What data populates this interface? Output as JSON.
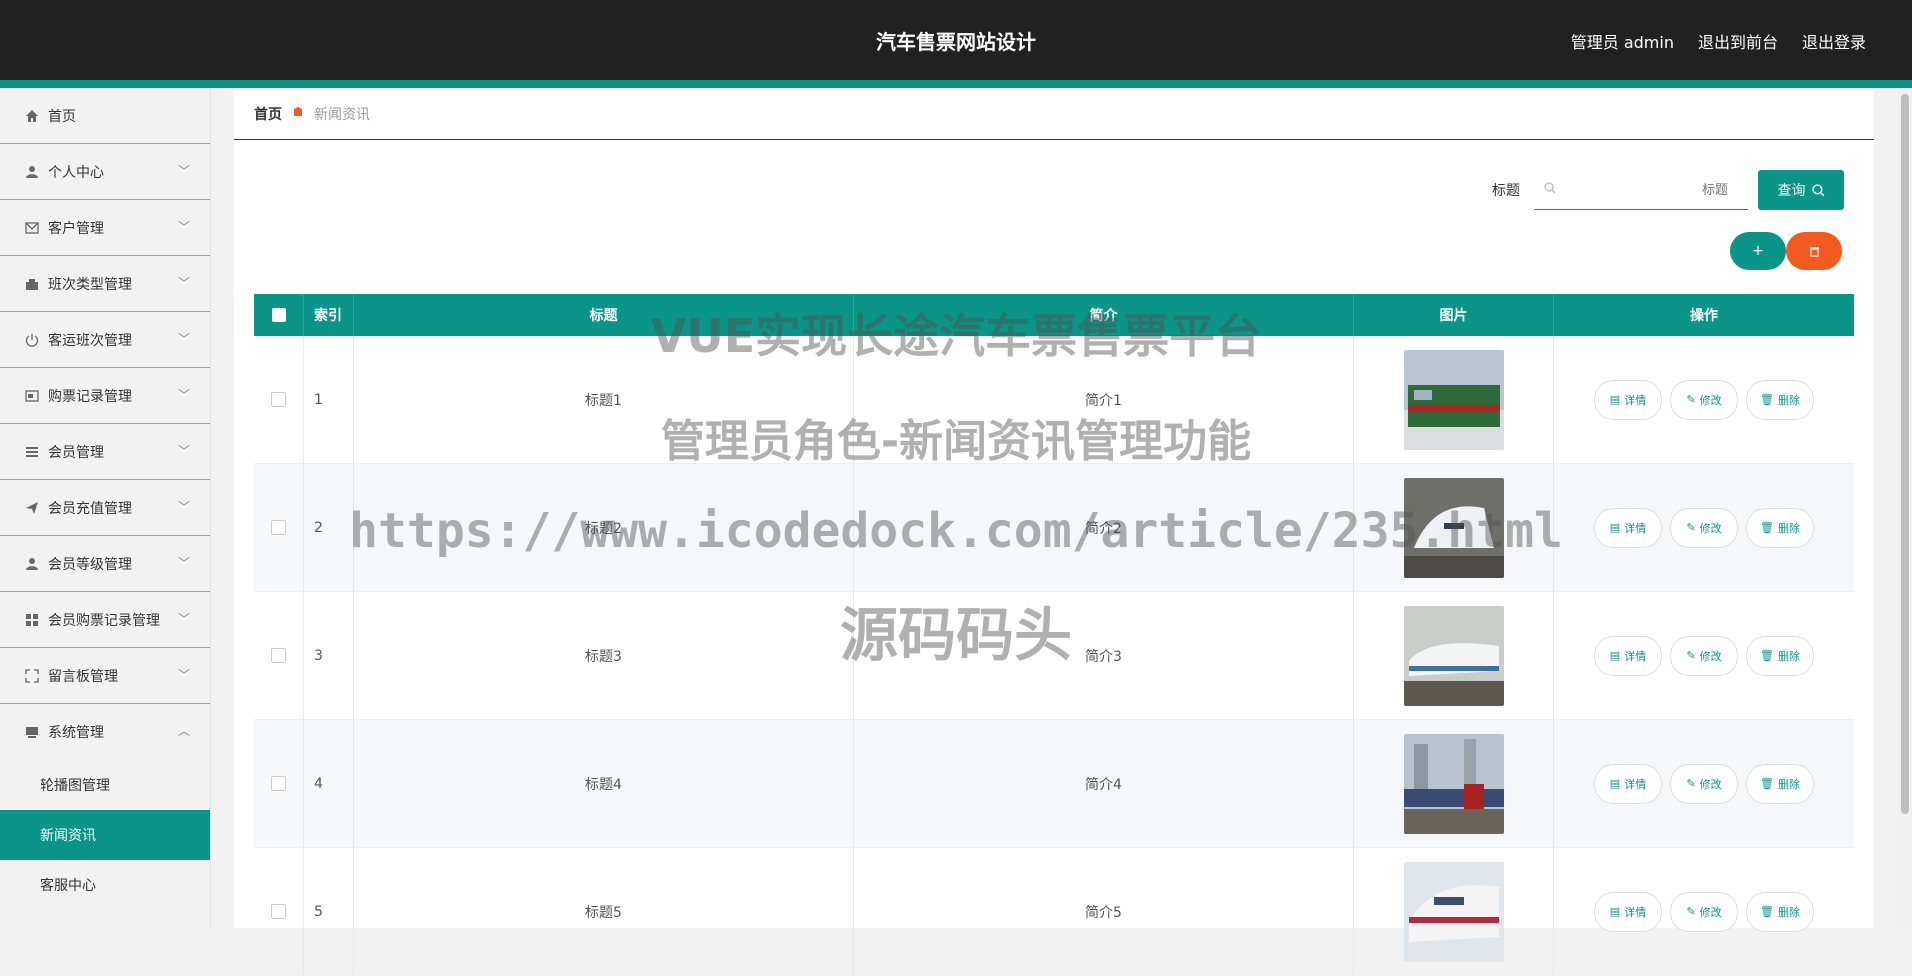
{
  "header": {
    "title": "汽车售票网站设计",
    "user_label": "管理员 admin",
    "to_front": "退出到前台",
    "logout": "退出登录"
  },
  "sidebar": {
    "items": [
      {
        "label": "首页",
        "icon": "home-icon",
        "expandable": false
      },
      {
        "label": "个人中心",
        "icon": "user-icon",
        "expandable": true
      },
      {
        "label": "客户管理",
        "icon": "mail-icon",
        "expandable": true
      },
      {
        "label": "班次类型管理",
        "icon": "tag-icon",
        "expandable": true
      },
      {
        "label": "客运班次管理",
        "icon": "power-icon",
        "expandable": true
      },
      {
        "label": "购票记录管理",
        "icon": "ticket-icon",
        "expandable": true
      },
      {
        "label": "会员管理",
        "icon": "list-icon",
        "expandable": true
      },
      {
        "label": "会员充值管理",
        "icon": "send-icon",
        "expandable": true
      },
      {
        "label": "会员等级管理",
        "icon": "user-icon",
        "expandable": true
      },
      {
        "label": "会员购票记录管理",
        "icon": "grid-icon",
        "expandable": true
      },
      {
        "label": "留言板管理",
        "icon": "fullscreen-icon",
        "expandable": true
      },
      {
        "label": "系统管理",
        "icon": "monitor-icon",
        "expandable": true,
        "expanded": true
      }
    ],
    "sub_items": [
      {
        "label": "轮播图管理",
        "active": false
      },
      {
        "label": "新闻资讯",
        "active": true
      },
      {
        "label": "客服中心",
        "active": false
      }
    ]
  },
  "breadcrumb": {
    "home": "首页",
    "current": "新闻资讯"
  },
  "search": {
    "label": "标题",
    "placeholder": "标题",
    "button": "查询"
  },
  "actions": {
    "add": "+",
    "delete_icon": "trash-icon"
  },
  "table": {
    "headers": {
      "index": "索引",
      "title": "标题",
      "intro": "简介",
      "image": "图片",
      "ops": "操作"
    },
    "op_labels": {
      "detail": "详情",
      "edit": "修改",
      "delete": "删除"
    },
    "rows": [
      {
        "index": "1",
        "title": "标题1",
        "intro": "简介1"
      },
      {
        "index": "2",
        "title": "标题2",
        "intro": "简介2"
      },
      {
        "index": "3",
        "title": "标题3",
        "intro": "简介3"
      },
      {
        "index": "4",
        "title": "标题4",
        "intro": "简介4"
      },
      {
        "index": "5",
        "title": "标题5",
        "intro": "简介5"
      }
    ]
  },
  "watermark": {
    "line1": "VUE实现长途汽车票售票平台",
    "line2": "管理员角色-新闻资讯管理功能",
    "line3": "https://www.icodedock.com/article/235.html",
    "line4": "源码码头"
  },
  "colors": {
    "accent": "#0b9488",
    "danger": "#f25a1f",
    "topbar": "#212121"
  }
}
